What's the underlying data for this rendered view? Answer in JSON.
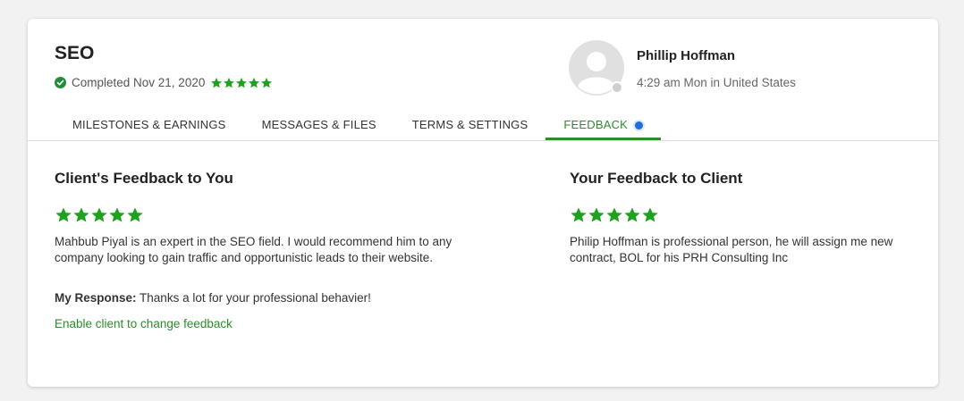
{
  "job": {
    "title": "SEO",
    "completed_text": "Completed Nov 21, 2020",
    "rating_stars": 5,
    "status_color": "#1e8e3e"
  },
  "client": {
    "name": "Phillip Hoffman",
    "local_time": "4:29 am Mon in United States"
  },
  "tabs": [
    {
      "label": "MILESTONES & EARNINGS",
      "active": false
    },
    {
      "label": "MESSAGES & FILES",
      "active": false
    },
    {
      "label": "TERMS & SETTINGS",
      "active": false
    },
    {
      "label": "FEEDBACK",
      "active": true
    }
  ],
  "client_feedback": {
    "heading": "Client's Feedback to You",
    "stars": 5,
    "text": "Mahbub Piyal is an expert in the SEO field. I would recommend him to any company looking to gain traffic and opportunistic leads to their website.",
    "response_label": "My Response:",
    "response_text": "Thanks a lot for your professional behavier!",
    "enable_link": "Enable client to change feedback"
  },
  "your_feedback": {
    "heading": "Your Feedback to Client",
    "stars": 5,
    "text": "Philip Hoffman is professional person, he will assign me new contract, BOL for his PRH Consulting Inc"
  },
  "colors": {
    "accent": "#2e8b2e",
    "star": "#1ea21e",
    "dot": "#1e6fd9"
  },
  "icons": [
    "check-circle-icon",
    "star-icon",
    "avatar-icon"
  ]
}
